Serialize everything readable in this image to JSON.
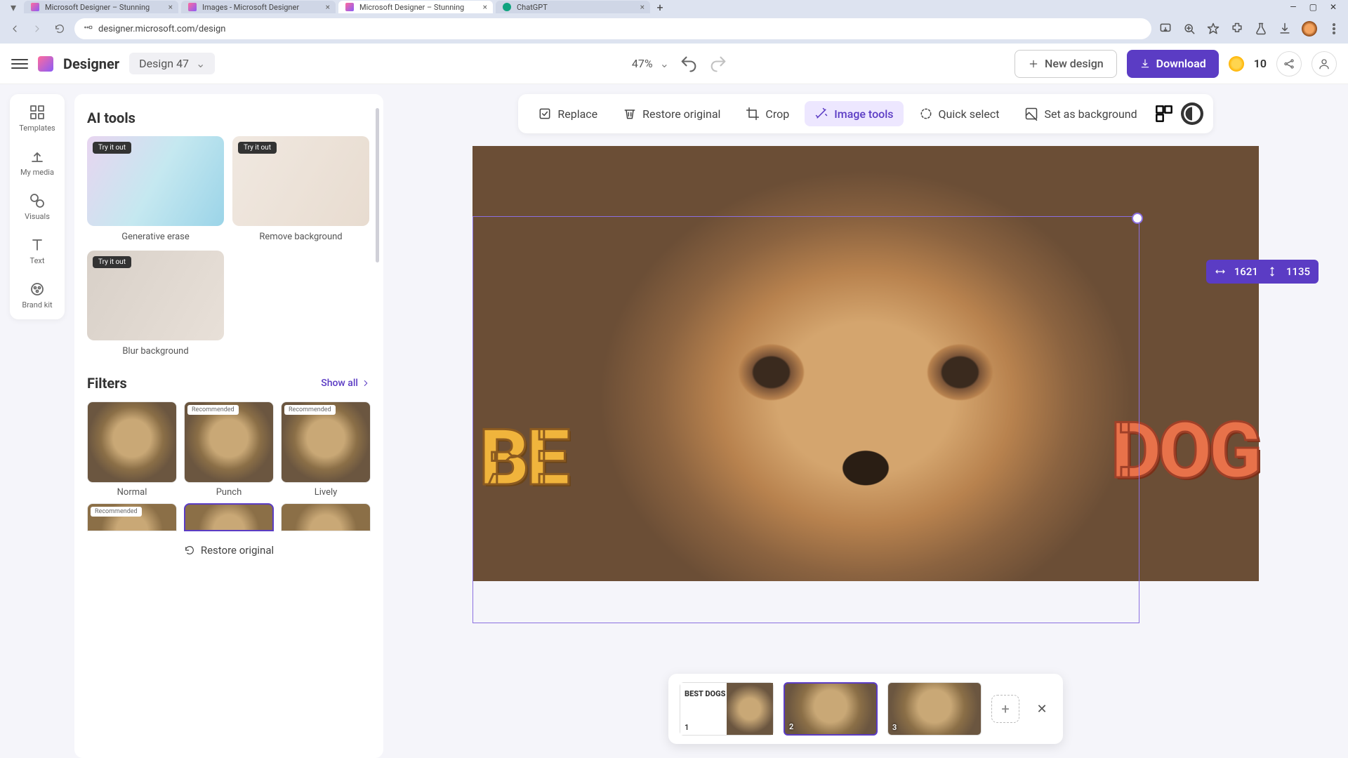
{
  "browser": {
    "tabs": [
      {
        "title": "Microsoft Designer – Stunning"
      },
      {
        "title": "Images - Microsoft Designer"
      },
      {
        "title": "Microsoft Designer – Stunning"
      },
      {
        "title": "ChatGPT"
      }
    ],
    "url": "designer.microsoft.com/design"
  },
  "header": {
    "brand": "Designer",
    "design_name": "Design 47",
    "zoom": "47%",
    "new_design": "New design",
    "download": "Download",
    "credits": "10"
  },
  "rail": {
    "templates": "Templates",
    "my_media": "My media",
    "visuals": "Visuals",
    "text": "Text",
    "brand_kit": "Brand kit"
  },
  "ai": {
    "title": "AI tools",
    "try": "Try it out",
    "tools": {
      "erase": "Generative erase",
      "removebg": "Remove background",
      "blurbg": "Blur background"
    },
    "filters_title": "Filters",
    "show_all": "Show all",
    "recommended": "Recommended",
    "filters": {
      "normal": "Normal",
      "punch": "Punch",
      "lively": "Lively"
    },
    "restore_bottom": "Restore original"
  },
  "toolbar": {
    "replace": "Replace",
    "restore": "Restore original",
    "crop": "Crop",
    "image_tools": "Image tools",
    "quick_select": "Quick select",
    "set_bg": "Set as background"
  },
  "selection": {
    "w": "1621",
    "h": "1135"
  },
  "canvas_text": {
    "be": "BE",
    "dog": "DOG"
  },
  "pages": {
    "p1": "1",
    "p2": "2",
    "p3": "3",
    "first_label": "BEST\nDOGS\nTAILS"
  }
}
